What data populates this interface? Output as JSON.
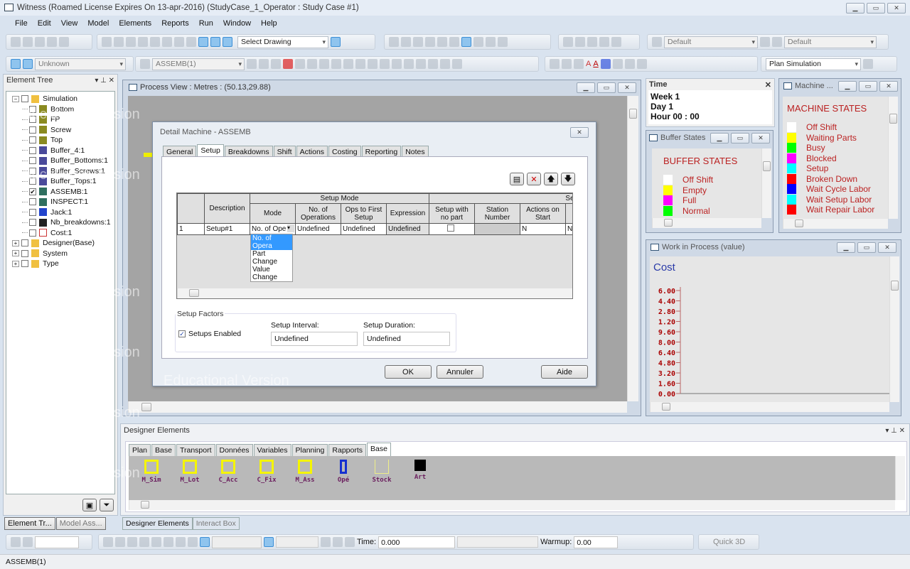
{
  "window": {
    "title": "Witness (Roamed License Expires On 13-apr-2016) (StudyCase_1_Operator : Study Case #1)"
  },
  "menu": [
    "File",
    "Edit",
    "View",
    "Model",
    "Elements",
    "Reports",
    "Run",
    "Window",
    "Help"
  ],
  "toolbar": {
    "select_drawing": "Select Drawing",
    "default1": "Default",
    "default2": "Default",
    "unknown": "Unknown",
    "element_combo": "ASSEMB(1)",
    "plan_simulation": "Plan Simulation"
  },
  "element_tree": {
    "title": "Element Tree",
    "items": [
      {
        "label": "Simulation",
        "level": 0,
        "type": "folder",
        "checked": false
      },
      {
        "label": "Bottom",
        "level": 1,
        "type": "part",
        "checked": false
      },
      {
        "label": "FP",
        "level": 1,
        "type": "part",
        "checked": false
      },
      {
        "label": "Screw",
        "level": 1,
        "type": "part",
        "checked": false
      },
      {
        "label": "Top",
        "level": 1,
        "type": "part",
        "checked": false
      },
      {
        "label": "Buffer_4:1",
        "level": 1,
        "type": "buffer",
        "checked": false
      },
      {
        "label": "Buffer_Bottoms:1",
        "level": 1,
        "type": "buffer",
        "checked": false
      },
      {
        "label": "Buffer_Screws:1",
        "level": 1,
        "type": "buffer",
        "checked": false
      },
      {
        "label": "Buffer_Tops:1",
        "level": 1,
        "type": "buffer",
        "checked": false
      },
      {
        "label": "ASSEMB:1",
        "level": 1,
        "type": "machine",
        "checked": true
      },
      {
        "label": "INSPECT:1",
        "level": 1,
        "type": "machine",
        "checked": false
      },
      {
        "label": "Jack:1",
        "level": 1,
        "type": "labor",
        "checked": false
      },
      {
        "label": "Nb_breakdowns:1",
        "level": 1,
        "type": "counter",
        "checked": false
      },
      {
        "label": "Cost:1",
        "level": 1,
        "type": "chart",
        "checked": false
      },
      {
        "label": "Designer(Base)",
        "level": 0,
        "type": "folder",
        "checked": false
      },
      {
        "label": "System",
        "level": 0,
        "type": "folder",
        "checked": false
      },
      {
        "label": "Type",
        "level": 0,
        "type": "folder",
        "checked": false
      }
    ],
    "tabs": [
      "Element Tr...",
      "Model Ass..."
    ]
  },
  "watermark": "Educational Version",
  "process_view": {
    "title": "Process View : Metres : (50.13,29.88)"
  },
  "dialog": {
    "title": "Detail Machine - ASSEMB",
    "tabs": [
      "General",
      "Setup",
      "Breakdowns",
      "Shift",
      "Actions",
      "Costing",
      "Reporting",
      "Notes"
    ],
    "active_tab": "Setup",
    "grid": {
      "group_setup_mode": "Setup Mode",
      "group_setup_duration": "Setup Dura",
      "headers": [
        "Description",
        "Mode",
        "No. of Operations",
        "Ops to First Setup",
        "Expression",
        "Setup with no part",
        "Station Number",
        "Actions on Start",
        "L"
      ],
      "row": {
        "index": "1",
        "description": "Setup#1",
        "mode": "No. of Ope",
        "no_ops": "Undefined",
        "ops_first": "Undefined",
        "expression": "Undefined",
        "station": "",
        "actions_start": "N",
        "l": "N"
      }
    },
    "mode_options": [
      "No. of Opera",
      "Part Change",
      "Value Change"
    ],
    "mode_selected": "No. of Opera",
    "setup_factors": {
      "legend": "Setup Factors",
      "enabled_label": "Setups Enabled",
      "enabled": true,
      "interval_label": "Setup Interval:",
      "interval": "Undefined",
      "duration_label": "Setup Duration:",
      "duration": "Undefined"
    },
    "buttons": {
      "ok": "OK",
      "cancel": "Annuler",
      "help": "Aide"
    }
  },
  "time": {
    "title": "Time",
    "week": "Week 1",
    "day": "Day 1",
    "hour": "Hour 00 : 00"
  },
  "buffer_states": {
    "title": "Buffer States",
    "heading": "BUFFER STATES",
    "items": [
      {
        "label": "Off Shift",
        "color": "#ffffff"
      },
      {
        "label": "Empty",
        "color": "#ffff00"
      },
      {
        "label": "Full",
        "color": "#ff00ff"
      },
      {
        "label": "Normal",
        "color": "#00ff00"
      }
    ]
  },
  "machine_states": {
    "title": "Machine ...",
    "heading": "MACHINE STATES",
    "items": [
      {
        "label": "Off Shift",
        "color": "#ffffff"
      },
      {
        "label": "Waiting Parts",
        "color": "#ffff00"
      },
      {
        "label": "Busy",
        "color": "#00ff00"
      },
      {
        "label": "Blocked",
        "color": "#ff00ff"
      },
      {
        "label": "Setup",
        "color": "#00ffff"
      },
      {
        "label": "Broken Down",
        "color": "#ff0000"
      },
      {
        "label": "Wait Cycle Labor",
        "color": "#0000ff"
      },
      {
        "label": "Wait Setup Labor",
        "color": "#00ffff"
      },
      {
        "label": "Wait Repair Labor",
        "color": "#ff0000"
      }
    ]
  },
  "wip": {
    "title": "Work in Process (value)"
  },
  "chart_data": {
    "type": "line",
    "title": "Cost",
    "yticks": [
      "6.00",
      "4.40",
      "2.80",
      "1.20",
      "9.60",
      "8.00",
      "6.40",
      "4.80",
      "3.20",
      "1.60",
      "0.00"
    ],
    "series": []
  },
  "designer": {
    "title": "Designer Elements",
    "tabs": [
      "Plan",
      "Base",
      "Transport",
      "Données",
      "Variables",
      "Planning",
      "Rapports",
      "Base"
    ],
    "active_tab": 7,
    "elements": [
      "M_Sim",
      "M_Lot",
      "C_Acc",
      "C_Fix",
      "M_Ass",
      "Opé",
      "Stock",
      "Art"
    ],
    "bottom_tabs": [
      "Designer Elements",
      "Interact Box"
    ]
  },
  "run_toolbar": {
    "time_label": "Time:",
    "time": "0.000",
    "warmup_label": "Warmup:",
    "warmup": "0.00",
    "quick3d": "Quick 3D"
  },
  "status": "ASSEMB(1)"
}
